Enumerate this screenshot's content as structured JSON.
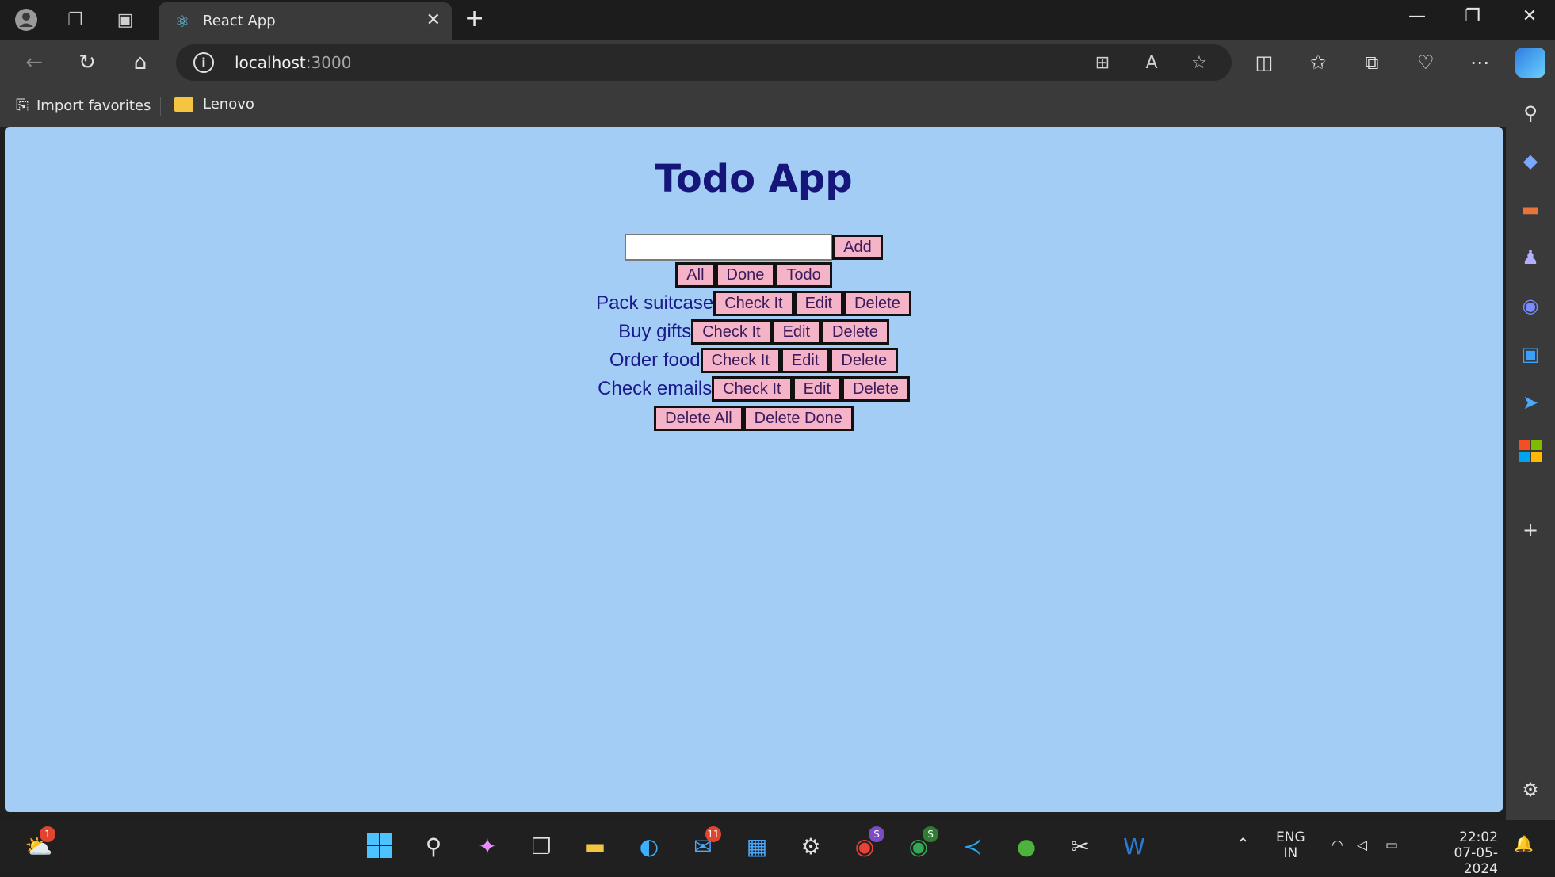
{
  "browser": {
    "tab_title": "React App",
    "url_host": "localhost",
    "url_port": ":3000",
    "favorites": [
      {
        "label": "Import favorites"
      },
      {
        "label": "Lenovo"
      }
    ]
  },
  "app": {
    "title": "Todo App",
    "input_value": "",
    "add_label": "Add",
    "filters": [
      {
        "label": "All"
      },
      {
        "label": "Done"
      },
      {
        "label": "Todo"
      }
    ],
    "todos": [
      {
        "text": "Pack suitcase",
        "check_label": "Check It",
        "edit_label": "Edit",
        "delete_label": "Delete"
      },
      {
        "text": "Buy gifts",
        "check_label": "Check It",
        "edit_label": "Edit",
        "delete_label": "Delete"
      },
      {
        "text": "Order food",
        "check_label": "Check It",
        "edit_label": "Edit",
        "delete_label": "Delete"
      },
      {
        "text": "Check emails",
        "check_label": "Check It",
        "edit_label": "Edit",
        "delete_label": "Delete"
      }
    ],
    "delete_all_label": "Delete All",
    "delete_done_label": "Delete Done"
  },
  "taskbar": {
    "weather_badge": "1",
    "mail_badge": "11",
    "chrome1_badge": "S",
    "chrome2_badge": "S",
    "lang_line1": "ENG",
    "lang_line2": "IN",
    "time": "22:02",
    "date": "07-05-2024"
  },
  "colors": {
    "page_background": "#a3cdf5",
    "title": "#15157a",
    "button_fill": "#f5b3c8",
    "todo_text": "#1a1a8c"
  }
}
